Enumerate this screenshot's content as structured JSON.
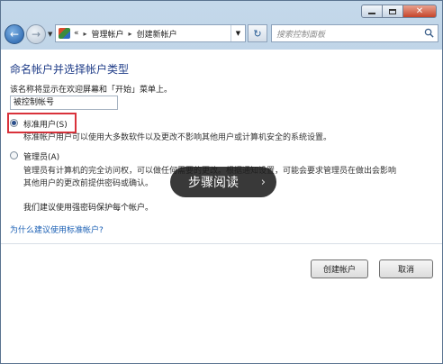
{
  "navbar": {
    "back": "←",
    "forward": "→",
    "breadcrumb_prefix": "«",
    "breadcrumb": [
      "管理帐户",
      "创建新帐户"
    ],
    "separator": "▸",
    "search_placeholder": "搜索控制面板",
    "refresh_glyph": "↻"
  },
  "main": {
    "heading": "命名帐户并选择帐户类型",
    "prompt": "该名称将显示在欢迎屏幕和「开始」菜单上。",
    "name_value": "被控制帐号",
    "options": [
      {
        "label": "标准用户(S)",
        "checked": true,
        "description": [
          "标准帐户用户可以使用大多数软件以及更改不影响其他用户或计算机安全的系统设置。"
        ]
      },
      {
        "label": "管理员(A)",
        "checked": false,
        "description": [
          "管理员有计算机的完全访问权，可以做任何需要的更改。根据通知设置，可能会要求管理员在做出会影响",
          "其他用户的更改前提供密码或确认。"
        ]
      }
    ],
    "recommend": "我们建议使用强密码保护每个帐户。",
    "why_link": "为什么建议使用标准帐户?",
    "create_button": "创建帐户",
    "cancel_button": "取消"
  },
  "overlay": {
    "label": "步骤阅读",
    "chevron": "›"
  },
  "colors": {
    "heading": "#1f3c88",
    "link": "#1a5fb4",
    "highlight": "#d9323b"
  }
}
